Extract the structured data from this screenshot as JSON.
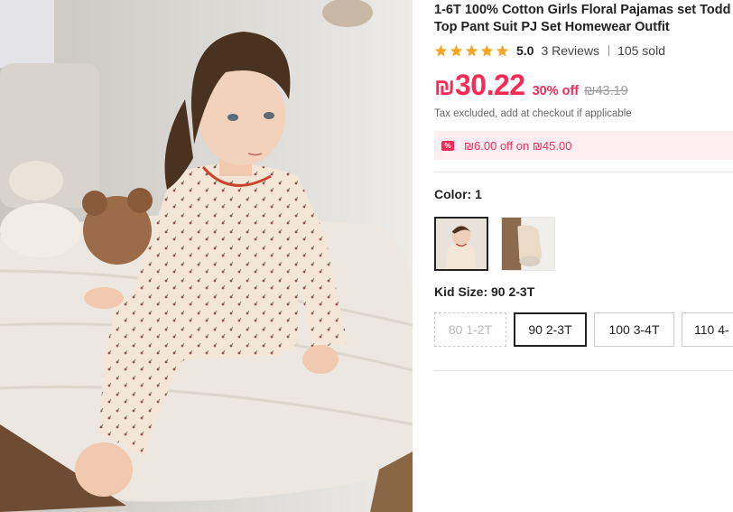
{
  "product": {
    "title_line1": "1-6T 100% Cotton Girls Floral Pajamas set Todd",
    "title_line2": "Top Pant Suit PJ Set Homewear Outfit"
  },
  "rating": {
    "stars": 5,
    "score": "5.0",
    "reviews": "3 Reviews",
    "sold": "105 sold"
  },
  "price": {
    "currency": "₪",
    "current": "30.22",
    "discount": "30% off",
    "original": "₪43.19"
  },
  "tax_note": "Tax excluded, add at checkout if applicable",
  "coupon": {
    "icon": "%",
    "text": "₪6.00 off on ₪45.00"
  },
  "color": {
    "label": "Color: 1"
  },
  "size": {
    "label": "Kid Size: 90 2-3T",
    "options": [
      "80 1-2T",
      "90 2-3T",
      "100 3-4T",
      "110 4-"
    ]
  },
  "colors": {
    "accent": "#fa2a55",
    "star": "#f5a623",
    "coupon_bg": "#ffeef1"
  }
}
